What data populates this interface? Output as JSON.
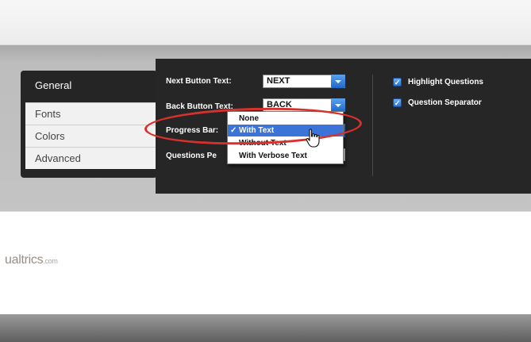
{
  "brand": {
    "logo_text": "ualtrics",
    "logo_suffix": ".com"
  },
  "tabs": [
    {
      "label": "General",
      "active": true
    },
    {
      "label": "Fonts",
      "active": false
    },
    {
      "label": "Colors",
      "active": false
    },
    {
      "label": "Advanced",
      "active": false
    }
  ],
  "settings": {
    "next_button": {
      "label": "Next Button Text:",
      "value": "NEXT"
    },
    "back_button": {
      "label": "Back Button Text:",
      "value": "BACK"
    },
    "progress_bar": {
      "label": "Progress Bar:",
      "value": "With Text"
    },
    "questions_per_page": {
      "label": "Questions Pe"
    },
    "checkboxes": [
      {
        "label": "Highlight Questions",
        "checked": true
      },
      {
        "label": "Question Separator",
        "checked": true
      }
    ]
  },
  "progress_dropdown": {
    "options": [
      "None",
      "With Text",
      "Without Text",
      "With Verbose Text"
    ],
    "selected": "With Text",
    "check_glyph": "✓"
  },
  "colors": {
    "panel_bg": "#262626",
    "accent_blue": "#3b73d8",
    "highlight_red": "#d8312c"
  },
  "icons": {
    "cursor": "hand-pointer-icon",
    "dropdown_arrow": "chevron-down-icon",
    "checkbox": "checkbox-checked-icon"
  }
}
